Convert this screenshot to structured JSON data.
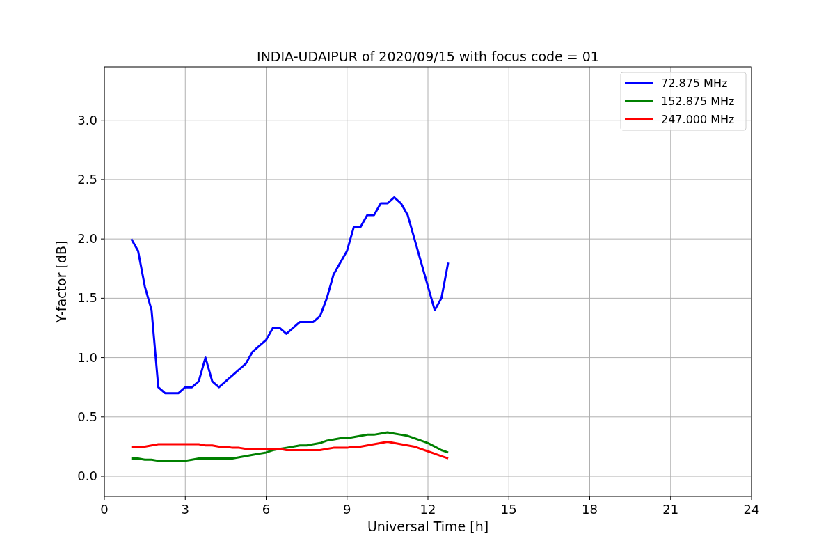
{
  "figure": {
    "chart_data": {
      "type": "line",
      "title": "INDIA-UDAIPUR of 2020/09/15 with focus code = 01",
      "xlabel": "Universal Time [h]",
      "ylabel": "Y-factor [dB]",
      "x": [
        1,
        1.25,
        1.5,
        1.75,
        2,
        2.25,
        2.5,
        2.75,
        3,
        3.25,
        3.5,
        3.75,
        4,
        4.25,
        4.5,
        4.75,
        5,
        5.25,
        5.5,
        5.75,
        6,
        6.25,
        6.5,
        6.75,
        7,
        7.25,
        7.5,
        7.75,
        8,
        8.25,
        8.5,
        8.75,
        9,
        9.25,
        9.5,
        9.75,
        10,
        10.25,
        10.5,
        10.75,
        11,
        11.25,
        11.5,
        11.75,
        12,
        12.25,
        12.5,
        12.75
      ],
      "series": [
        {
          "name": "72.875 MHz",
          "color": "#0000ff",
          "values": [
            2.0,
            1.9,
            1.6,
            1.4,
            0.75,
            0.7,
            0.7,
            0.7,
            0.75,
            0.75,
            0.8,
            1.0,
            0.8,
            0.75,
            0.8,
            0.85,
            0.9,
            0.95,
            1.05,
            1.1,
            1.15,
            1.25,
            1.25,
            1.2,
            1.25,
            1.3,
            1.3,
            1.3,
            1.35,
            1.5,
            1.7,
            1.8,
            1.9,
            2.1,
            2.1,
            2.2,
            2.2,
            2.3,
            2.3,
            2.35,
            2.3,
            2.2,
            2.0,
            1.8,
            1.6,
            1.4,
            1.5,
            1.8
          ]
        },
        {
          "name": "152.875 MHz",
          "color": "#008000",
          "values": [
            0.15,
            0.15,
            0.14,
            0.14,
            0.13,
            0.13,
            0.13,
            0.13,
            0.13,
            0.14,
            0.15,
            0.15,
            0.15,
            0.15,
            0.15,
            0.15,
            0.16,
            0.17,
            0.18,
            0.19,
            0.2,
            0.22,
            0.23,
            0.24,
            0.25,
            0.26,
            0.26,
            0.27,
            0.28,
            0.3,
            0.31,
            0.32,
            0.32,
            0.33,
            0.34,
            0.35,
            0.35,
            0.36,
            0.37,
            0.36,
            0.35,
            0.34,
            0.32,
            0.3,
            0.28,
            0.25,
            0.22,
            0.2
          ]
        },
        {
          "name": "247.000 MHz",
          "color": "#ff0000",
          "values": [
            0.25,
            0.25,
            0.25,
            0.26,
            0.27,
            0.27,
            0.27,
            0.27,
            0.27,
            0.27,
            0.27,
            0.26,
            0.26,
            0.25,
            0.25,
            0.24,
            0.24,
            0.23,
            0.23,
            0.23,
            0.23,
            0.23,
            0.23,
            0.22,
            0.22,
            0.22,
            0.22,
            0.22,
            0.22,
            0.23,
            0.24,
            0.24,
            0.24,
            0.25,
            0.25,
            0.26,
            0.27,
            0.28,
            0.29,
            0.28,
            0.27,
            0.26,
            0.25,
            0.23,
            0.21,
            0.19,
            0.17,
            0.15
          ]
        }
      ],
      "grid": true,
      "legend": true,
      "xlim": [
        0,
        24
      ],
      "ylim": [
        -0.17,
        3.45
      ],
      "xticks": [
        0,
        3,
        6,
        9,
        12,
        15,
        18,
        21,
        24
      ],
      "yticks": [
        {
          "value": 0,
          "label": "0.0"
        },
        {
          "value": 0.5,
          "label": "0.5"
        },
        {
          "value": 1,
          "label": "1.0"
        },
        {
          "value": 1.5,
          "label": "1.5"
        },
        {
          "value": 2,
          "label": "2.0"
        },
        {
          "value": 2.5,
          "label": "2.5"
        },
        {
          "value": 3,
          "label": "3.0"
        }
      ]
    }
  }
}
